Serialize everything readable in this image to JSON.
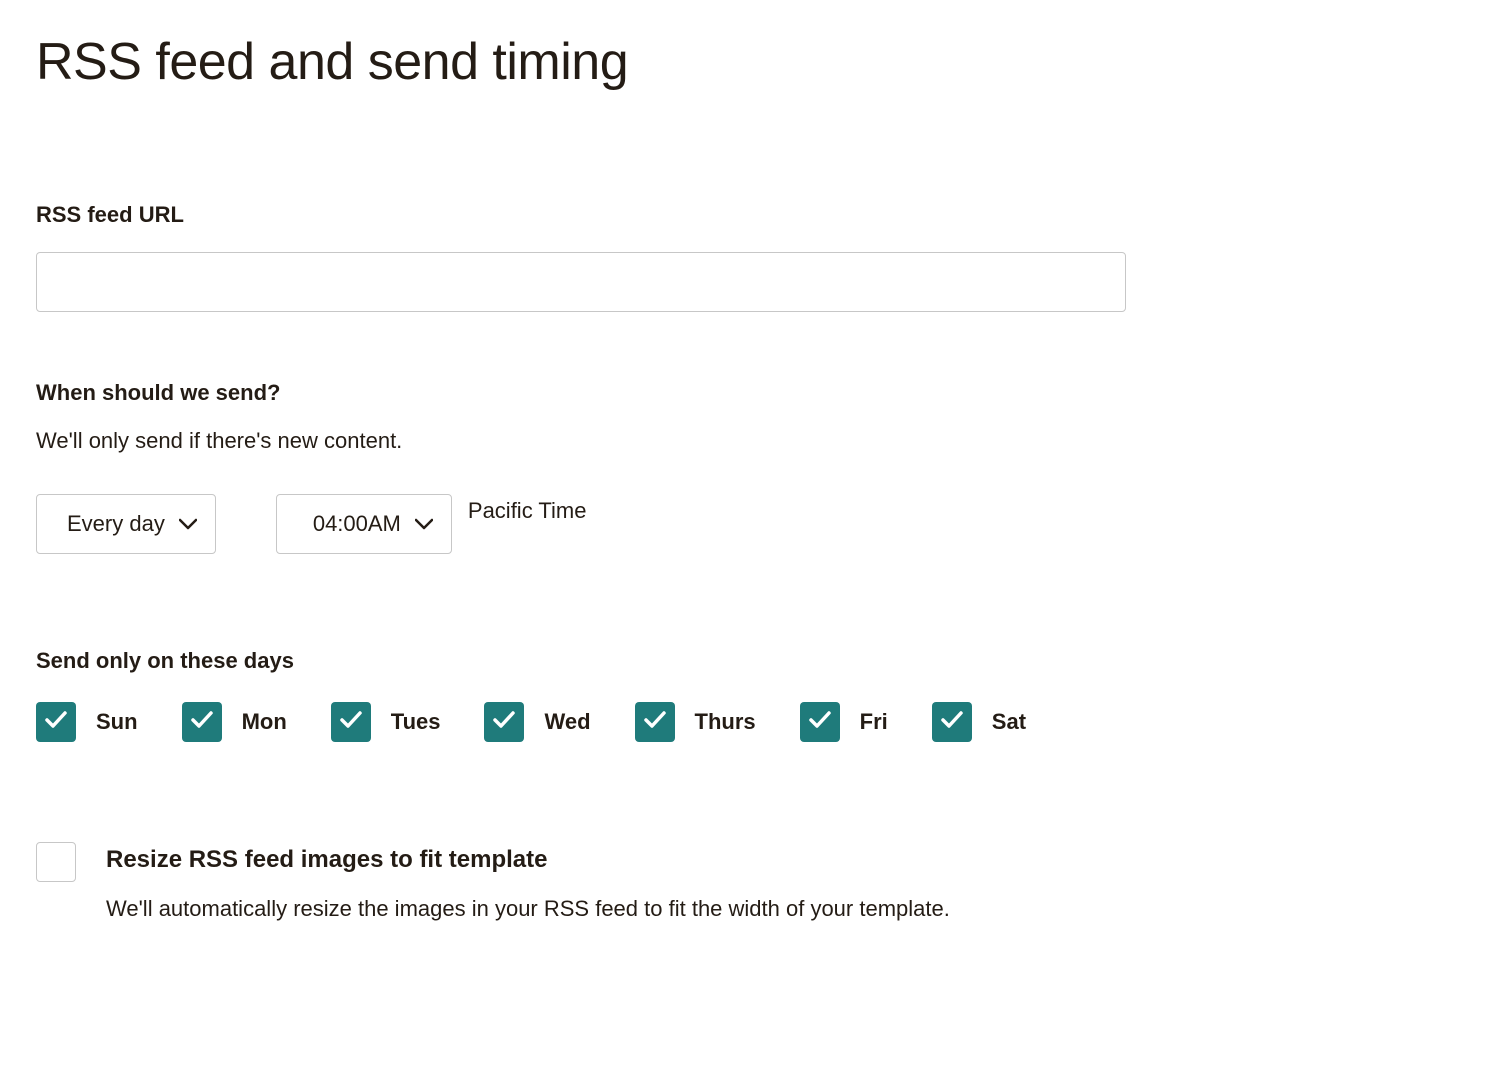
{
  "page": {
    "title": "RSS feed and send timing"
  },
  "rss_url": {
    "label": "RSS feed URL",
    "value": ""
  },
  "schedule": {
    "label": "When should we send?",
    "helper": "We'll only send if there's new content.",
    "frequency": "Every day",
    "time": "04:00AM",
    "timezone": "Pacific Time"
  },
  "days_section": {
    "label": "Send only on these days",
    "days": [
      {
        "label": "Sun",
        "checked": true
      },
      {
        "label": "Mon",
        "checked": true
      },
      {
        "label": "Tues",
        "checked": true
      },
      {
        "label": "Wed",
        "checked": true
      },
      {
        "label": "Thurs",
        "checked": true
      },
      {
        "label": "Fri",
        "checked": true
      },
      {
        "label": "Sat",
        "checked": true
      }
    ]
  },
  "resize": {
    "title": "Resize RSS feed images to fit template",
    "description": "We'll automatically resize the images in your RSS feed to fit the width of your template.",
    "checked": false
  },
  "colors": {
    "checkbox_teal": "#1f7b7b"
  }
}
